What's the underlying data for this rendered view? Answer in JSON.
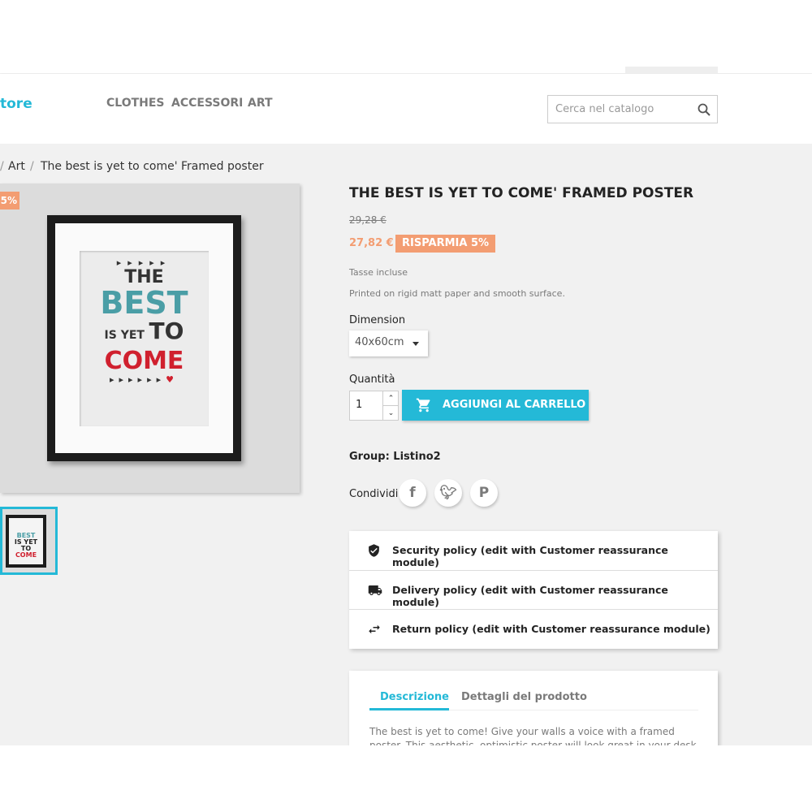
{
  "header": {
    "logo_text": "tore",
    "nav": [
      "CLOTHES",
      "ACCESSORI",
      "ART"
    ],
    "search_placeholder": "Cerca nel catalogo"
  },
  "breadcrumb": [
    "Art",
    "The best is yet to come' Framed poster"
  ],
  "product": {
    "discount_badge": "5%",
    "image_text": [
      "THE",
      "BEST",
      "IS YET",
      "TO",
      "COME"
    ],
    "title": "THE BEST IS YET TO COME' FRAMED POSTER",
    "old_price": "29,28 €",
    "price": "27,82 €",
    "save_label": "RISPARMIA 5%",
    "tax": "Tasse incluse",
    "short_desc": "Printed on rigid matt paper and smooth surface.",
    "dimension_label": "Dimension",
    "dimension_value": "40x60cm",
    "qty_label": "Quantità",
    "qty_value": "1",
    "add_to_cart": "AGGIUNGI AL CARRELLO",
    "group": "Group: Listino2",
    "share_label": "Condividi"
  },
  "reassurance": [
    "Security policy (edit with Customer reassurance module)",
    "Delivery policy (edit with Customer reassurance module)",
    "Return policy (edit with Customer reassurance module)"
  ],
  "tabs": {
    "items": [
      "Descrizione",
      "Dettagli del prodotto"
    ],
    "description": "The best is yet to come! Give your walls a voice with a framed poster. This aesthetic, optimistic poster will look great in your desk or in an open-space"
  },
  "colors": {
    "accent": "#24b9d7",
    "discount": "#f39d72"
  }
}
